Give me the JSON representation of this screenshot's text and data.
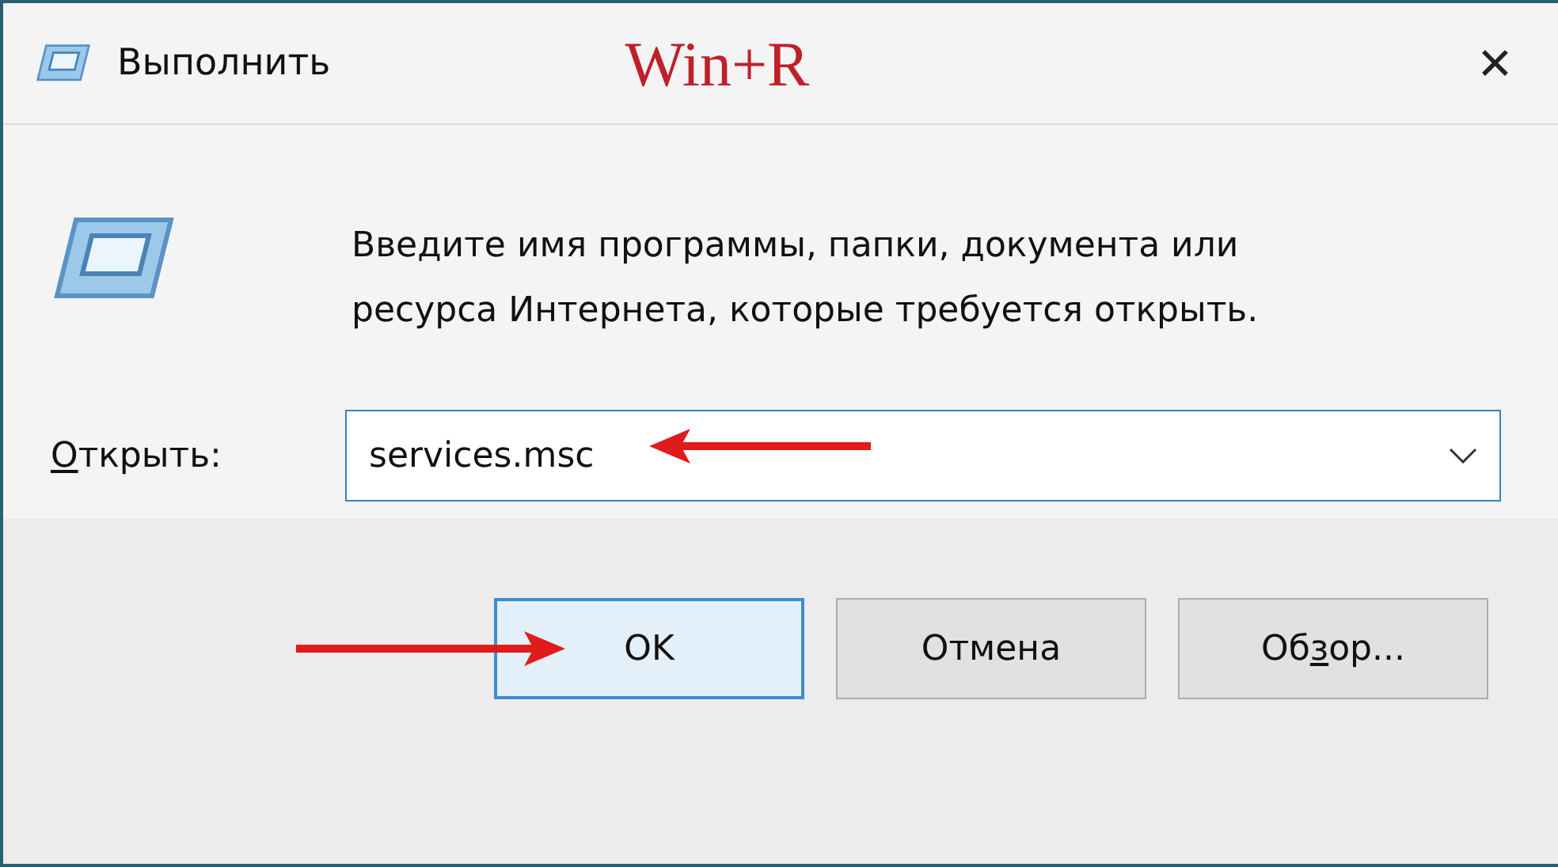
{
  "window": {
    "title": "Выполнить",
    "close": "✕"
  },
  "annotation": {
    "text": "Win+R"
  },
  "prompt": "Введите имя программы, папки, документа или ресурса Интернета, которые требуется открыть.",
  "open_field": {
    "label": [
      {
        "text": "О",
        "underlined": true
      },
      {
        "text": "ткрыть:",
        "underlined": false
      }
    ],
    "value": "services.msc",
    "arrow": true
  },
  "buttons": [
    {
      "label": [
        {
          "text": "OK",
          "underlined": false
        }
      ],
      "selected": true,
      "arrow": true
    },
    {
      "label": [
        {
          "text": "Отмена",
          "underlined": false
        }
      ],
      "selected": false,
      "arrow": false
    },
    {
      "label": [
        {
          "text": "Об",
          "underlined": false
        },
        {
          "text": "з",
          "underlined": true
        },
        {
          "text": "ор...",
          "underlined": false
        }
      ],
      "selected": false,
      "arrow": false
    }
  ]
}
